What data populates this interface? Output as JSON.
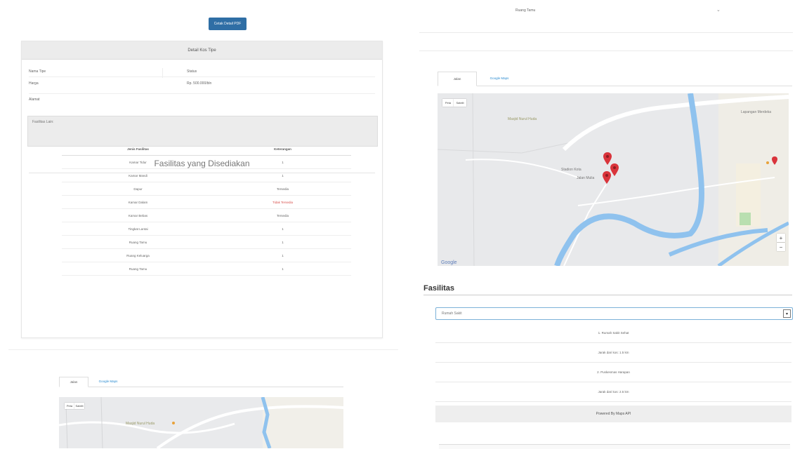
{
  "left": {
    "print_button": "Cetak Detail PDF",
    "panel_title": "Detail Kos Tipe",
    "info_left": [
      "Nama Tipe",
      "Harga",
      "Alamat"
    ],
    "info_right": [
      "Status",
      "Rp. 500.000/bln"
    ],
    "notes": "Fasilitas Lain:",
    "facilities_title": "Fasilitas yang Disediakan",
    "table_headers": [
      "Jenis Fasilitas",
      "Keterangan"
    ],
    "table_rows": [
      [
        "Kamar Tidur",
        "1"
      ],
      [
        "Kamar Mandi",
        "1"
      ],
      [
        "Dapur",
        "Tersedia"
      ],
      [
        "Kamar Dalam",
        "Tidak Tersedia"
      ],
      [
        "Kamar Bebas",
        "Tersedia"
      ],
      [
        "Tingkat Lantai",
        "1"
      ],
      [
        "Ruang Tamu",
        "1"
      ],
      [
        "Ruang Keluarga",
        "1"
      ],
      [
        "Ruang Tamu",
        "1"
      ]
    ],
    "map_tabs": [
      "Jalan",
      "Google Maps"
    ],
    "map_buttons": [
      "Peta",
      "Satelit"
    ],
    "map_labels": [
      "Masjid Nurul Huda"
    ]
  },
  "right": {
    "select_text": "Ruang Tamu",
    "map_tabs": [
      "Jalan",
      "Google Maps"
    ],
    "map_buttons": [
      "Peta",
      "Satelit"
    ],
    "map_labels": [
      "Masjid Nurul Huda",
      "Stadion Kota",
      "Lapangan Merdeka",
      "Jalan Mulia"
    ],
    "map_zoom": [
      "+",
      "−"
    ],
    "facilities_heading": "Fasilitas",
    "facilities_select": "Rumah Sakit",
    "facilities_items": [
      "1. Rumah Sakit Sehat",
      "Jarak dari kos: 1.5 km",
      "2. Puskesmas Harapan",
      "Jarak dari kos: 2.5 km"
    ],
    "powered": "Powered By Maps API"
  },
  "colors": {
    "primary_button": "#2f6ea5",
    "link": "#2a8bd0",
    "map_marker": "#d9343b",
    "river": "#8fc2ee",
    "danger_text": "#d9534f"
  }
}
